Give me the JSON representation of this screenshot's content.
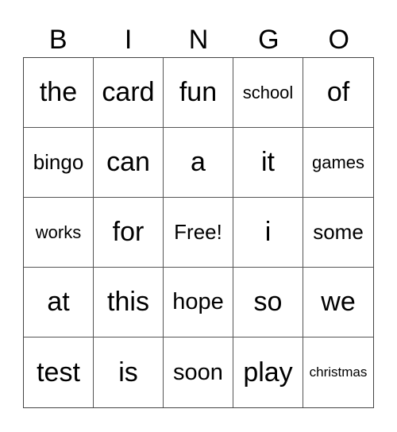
{
  "header": [
    "B",
    "I",
    "N",
    "G",
    "O"
  ],
  "grid": [
    [
      "the",
      "card",
      "fun",
      "school",
      "of"
    ],
    [
      "bingo",
      "can",
      "a",
      "it",
      "games"
    ],
    [
      "works",
      "for",
      "Free!",
      "i",
      "some"
    ],
    [
      "at",
      "this",
      "hope",
      "so",
      "we"
    ],
    [
      "test",
      "is",
      "soon",
      "play",
      "christmas"
    ]
  ]
}
